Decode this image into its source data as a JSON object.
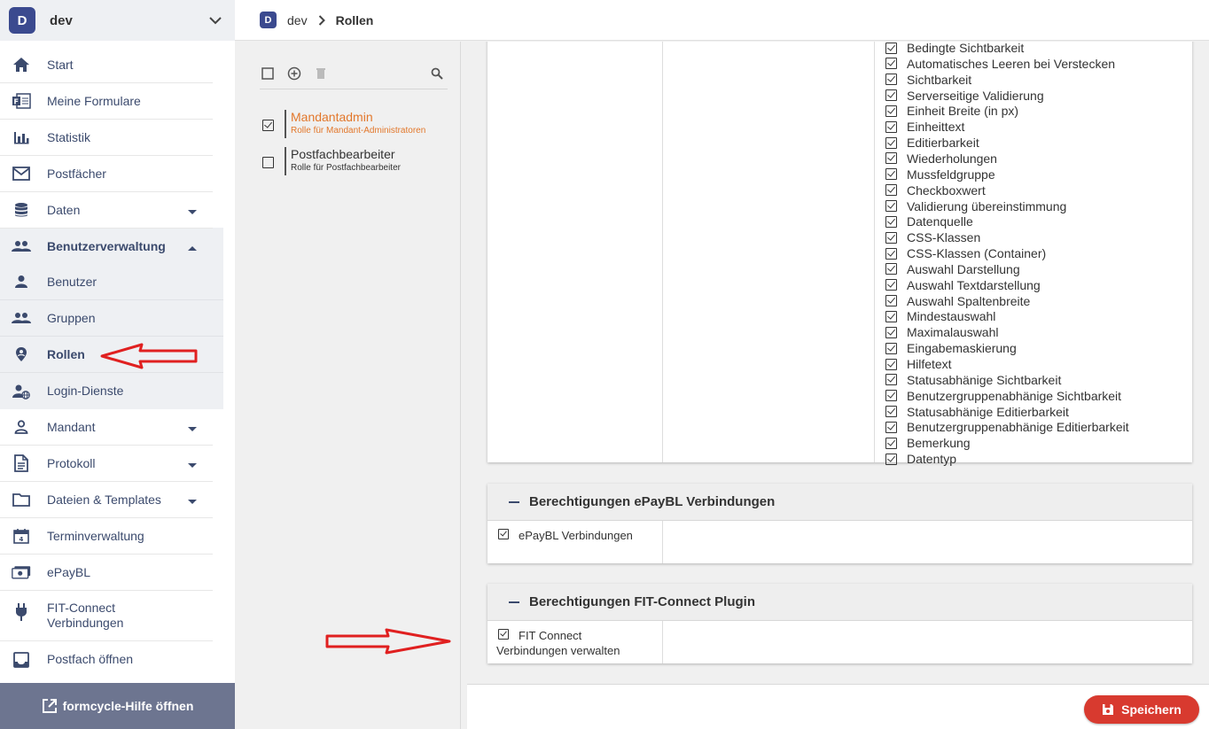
{
  "tenant": {
    "badge": "D",
    "name": "dev"
  },
  "nav": {
    "items": [
      {
        "label": "Start",
        "icon": "home-icon"
      },
      {
        "label": "Meine Formulare",
        "icon": "forms-icon"
      },
      {
        "label": "Statistik",
        "icon": "chart-icon"
      },
      {
        "label": "Postfächer",
        "icon": "mail-icon"
      },
      {
        "label": "Daten",
        "icon": "database-icon"
      },
      {
        "label": "Benutzerverwaltung",
        "icon": "users-icon"
      },
      {
        "label": "Benutzer",
        "icon": "user-icon"
      },
      {
        "label": "Gruppen",
        "icon": "group-icon"
      },
      {
        "label": "Rollen",
        "icon": "role-pin-icon"
      },
      {
        "label": "Login-Dienste",
        "icon": "login-service-icon"
      },
      {
        "label": "Mandant",
        "icon": "person-outline-icon"
      },
      {
        "label": "Protokoll",
        "icon": "document-icon"
      },
      {
        "label": "Dateien & Templates",
        "icon": "folder-icon"
      },
      {
        "label": "Terminverwaltung",
        "icon": "calendar-icon"
      },
      {
        "label": "ePayBL",
        "icon": "money-icon"
      },
      {
        "label": "FIT-Connect Verbindungen",
        "icon": "plug-icon"
      },
      {
        "label": "Postfach öffnen",
        "icon": "inbox-icon"
      }
    ],
    "help_label": "formcycle-Hilfe öffnen"
  },
  "breadcrumb": {
    "badge": "D",
    "tenant": "dev",
    "current": "Rollen"
  },
  "roles": [
    {
      "title": "Mandantadmin",
      "description": "Rolle für Mandant-Administratoren",
      "checked": true,
      "active": true
    },
    {
      "title": "Postfachbearbeiter",
      "description": "Rolle für Postfachbearbeiter",
      "checked": false,
      "active": false
    }
  ],
  "permissions": {
    "partial_top_item": "Bedingte Sichtbarkeit",
    "items": [
      "Automatisches Leeren bei Verstecken",
      "Sichtbarkeit",
      "Serverseitige Validierung",
      "Einheit Breite (in px)",
      "Einheittext",
      "Editierbarkeit",
      "Wiederholungen",
      "Mussfeldgruppe",
      "Checkboxwert",
      "Validierung übereinstimmung",
      "Datenquelle",
      "CSS-Klassen",
      "CSS-Klassen (Container)",
      "Auswahl Darstellung",
      "Auswahl Textdarstellung",
      "Auswahl Spaltenbreite",
      "Mindestauswahl",
      "Maximalauswahl",
      "Eingabemaskierung",
      "Hilfetext",
      "Statusabhänige Sichtbarkeit",
      "Benutzergruppenabhänige Sichtbarkeit",
      "Statusabhänige Editierbarkeit",
      "Benutzergruppenabhänige Editierbarkeit",
      "Bemerkung",
      "Datentyp"
    ]
  },
  "sections": [
    {
      "title": "Berechtigungen ePayBL Verbindungen",
      "item": "ePayBL Verbindungen"
    },
    {
      "title": "Berechtigungen FIT-Connect Plugin",
      "item": "FIT Connect Verbindungen verwalten"
    }
  ],
  "save_label": "Speichern",
  "colors": {
    "accent": "#3b4a8f",
    "active_role": "#e2772b",
    "save": "#d83a2f",
    "arrow": "#e02020"
  }
}
